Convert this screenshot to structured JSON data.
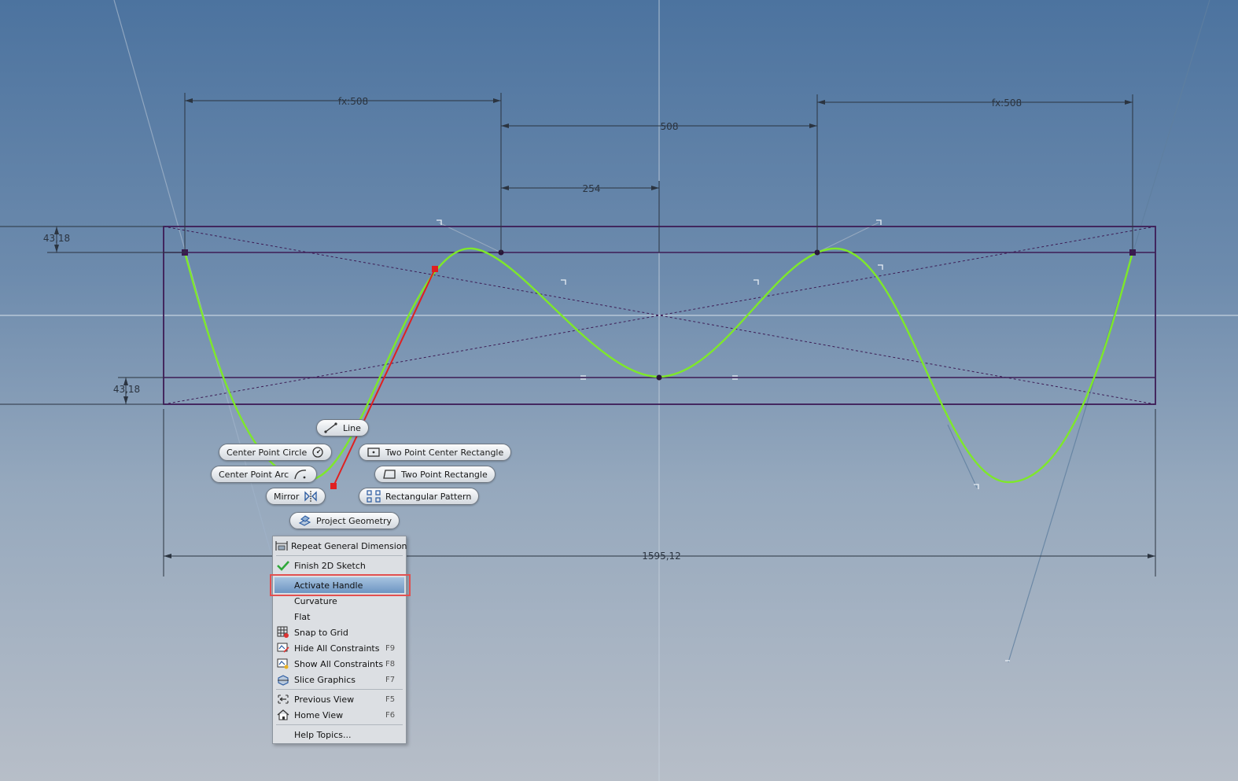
{
  "colors": {
    "sketch_outline": "#3d1c55",
    "spline": "#7ee82a",
    "handle": "#e02020",
    "dimension": "#2b3440",
    "menu_highlight": "#7c9fcb",
    "highlight_box": "#e25050"
  },
  "dimensions": {
    "left_fx": "fx:508",
    "right_fx": "fx:508",
    "center_width": "508",
    "half_width": "254",
    "top_height": "43,18",
    "bottom_height": "43,18",
    "overall_width": "1595,12"
  },
  "marking_menu": {
    "line": {
      "label": "Line",
      "icon": "line-icon"
    },
    "center_point_circle": {
      "label": "Center Point Circle",
      "icon": "circle-icon"
    },
    "two_point_center_rectangle": {
      "label": "Two Point Center Rectangle",
      "icon": "center-rectangle-icon"
    },
    "center_point_arc": {
      "label": "Center Point Arc",
      "icon": "arc-icon"
    },
    "two_point_rectangle": {
      "label": "Two Point Rectangle",
      "icon": "rectangle-icon"
    },
    "mirror": {
      "label": "Mirror",
      "icon": "mirror-icon"
    },
    "rectangular_pattern": {
      "label": "Rectangular Pattern",
      "icon": "rectangular-pattern-icon"
    },
    "project_geometry": {
      "label": "Project Geometry",
      "icon": "project-geometry-icon"
    }
  },
  "context_menu": {
    "items": [
      {
        "label": "Repeat General Dimension",
        "shortcut": "",
        "icon": "dimension-icon"
      },
      {
        "label": "Finish 2D Sketch",
        "shortcut": "",
        "icon": "checkmark-icon"
      },
      {
        "label": "Activate Handle",
        "shortcut": "",
        "icon": ""
      },
      {
        "label": "Curvature",
        "shortcut": "",
        "icon": ""
      },
      {
        "label": "Flat",
        "shortcut": "",
        "icon": ""
      },
      {
        "label": "Snap to Grid",
        "shortcut": "",
        "icon": "grid-icon"
      },
      {
        "label": "Hide All Constraints",
        "shortcut": "F9",
        "icon": "hide-constraints-icon"
      },
      {
        "label": "Show All Constraints",
        "shortcut": "F8",
        "icon": "show-constraints-icon"
      },
      {
        "label": "Slice Graphics",
        "shortcut": "F7",
        "icon": "slice-graphics-icon"
      },
      {
        "label": "Previous View",
        "shortcut": "F5",
        "icon": "previous-view-icon"
      },
      {
        "label": "Home View",
        "shortcut": "F6",
        "icon": "home-icon"
      },
      {
        "label": "Help Topics...",
        "shortcut": "",
        "icon": ""
      }
    ],
    "highlighted": "Activate Handle"
  }
}
